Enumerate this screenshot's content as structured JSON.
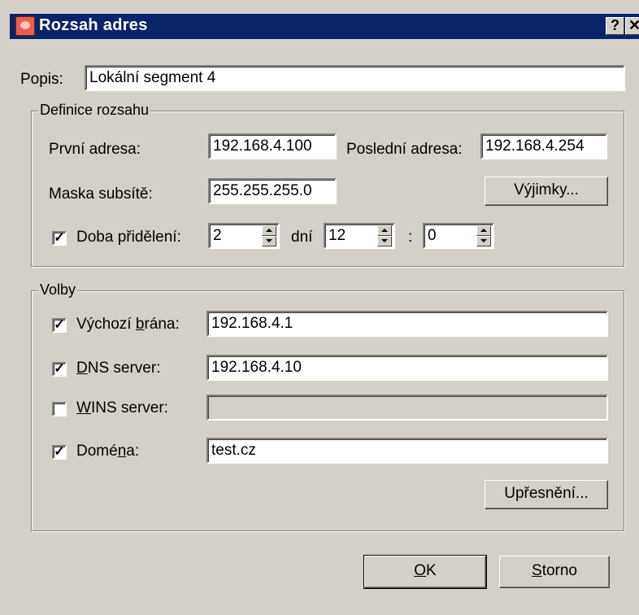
{
  "window": {
    "title": "Rozsah adres",
    "help_label": "?",
    "close_label": "✕"
  },
  "description": {
    "label": "Popis:",
    "value": "Lokální segment 4"
  },
  "range_group": {
    "title": "Definice rozsahu",
    "first_address_label": "První adresa:",
    "first_address_value": "192.168.4.100",
    "last_address_label": "Poslední adresa:",
    "last_address_value": "192.168.4.254",
    "subnet_mask_label": "Maska subsítě:",
    "subnet_mask_value": "255.255.255.0",
    "exceptions_button": "Výjimky...",
    "lease_label": "Doba přidělení:",
    "lease_checked": true,
    "lease_days_value": "2",
    "days_label": "dní",
    "lease_hours_value": "12",
    "time_separator": ":",
    "lease_minutes_value": "0"
  },
  "options_group": {
    "title": "Volby",
    "gateway": {
      "label_pre": "Výchozí ",
      "label_ul": "b",
      "label_post": "rána:",
      "checked": true,
      "value": "192.168.4.1"
    },
    "dns": {
      "label_pre": "",
      "label_ul": "D",
      "label_post": "NS server:",
      "checked": true,
      "value": "192.168.4.10"
    },
    "wins": {
      "label_pre": "",
      "label_ul": "W",
      "label_post": "INS server:",
      "checked": false,
      "value": ""
    },
    "domain": {
      "label_pre": "Domé",
      "label_ul": "n",
      "label_post": "a:",
      "checked": true,
      "value": "test.cz"
    },
    "advanced_button": "Upřesnění..."
  },
  "buttons": {
    "ok_ul": "O",
    "ok_rest": "K",
    "cancel_ul": "S",
    "cancel_rest": "torno"
  }
}
